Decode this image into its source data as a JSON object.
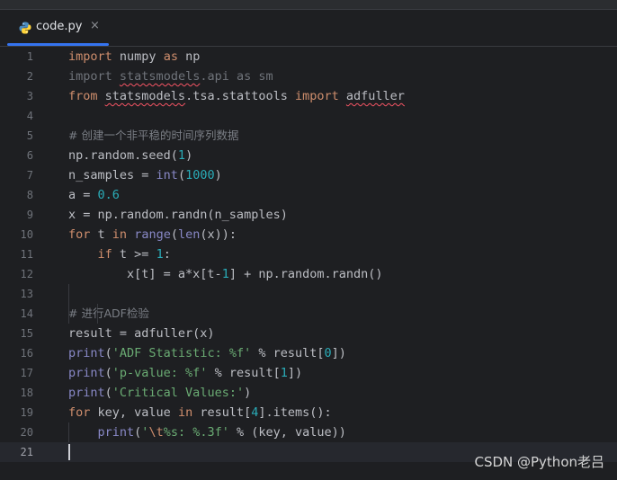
{
  "tab": {
    "filename": "code.py",
    "close_glyph": "×",
    "icon": "python-icon"
  },
  "editor": {
    "line_numbers": [
      "1",
      "2",
      "3",
      "4",
      "5",
      "6",
      "7",
      "8",
      "9",
      "10",
      "11",
      "12",
      "13",
      "14",
      "15",
      "16",
      "17",
      "18",
      "19",
      "20",
      "21"
    ],
    "current_line": 21,
    "comments": {
      "line5": "# 创建一个非平稳的时间序列数据",
      "line14": "# 进行ADF检验"
    }
  },
  "watermark": "CSDN @Python老吕",
  "colors": {
    "background": "#1e1f22",
    "keyword": "#cf8e6d",
    "number": "#2aacb8",
    "string": "#6aab73",
    "builtin": "#8888c6",
    "comment": "#7a7e85",
    "accent": "#3574f0"
  }
}
